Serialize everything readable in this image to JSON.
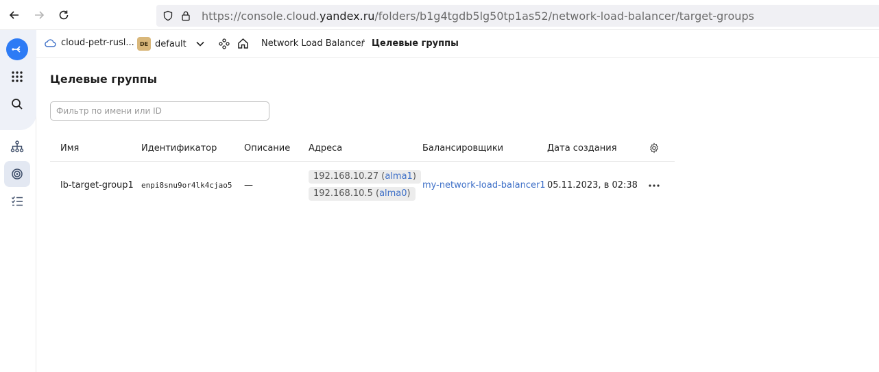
{
  "browser": {
    "url_prefix": "https://console.cloud.",
    "url_host": "yandex.ru",
    "url_path": "/folders/b1g4tgdb5lg50tp1as52/network-load-balancer/target-groups"
  },
  "header": {
    "cloud_name": "cloud-petr-rusl...",
    "folder_badge": "DE",
    "folder_name": "default",
    "breadcrumb_service": "Network Load Balancer",
    "breadcrumb_separator": "/",
    "breadcrumb_current": "Целевые группы"
  },
  "page": {
    "title": "Целевые группы",
    "filter_placeholder": "Фильтр по имени или ID"
  },
  "table": {
    "columns": [
      "Имя",
      "Идентификатор",
      "Описание",
      "Адреса",
      "Балансировщики",
      "Дата создания"
    ],
    "rows": [
      {
        "name": "lb-target-group1",
        "id": "enpi8snu9or4lk4cjao5",
        "description": "—",
        "addresses": [
          {
            "ip": "192.168.10.27",
            "host": "alma1"
          },
          {
            "ip": "192.168.10.5",
            "host": "alma0"
          }
        ],
        "balancer": "my-network-load-balancer1",
        "created": "05.11.2023, в 02:38"
      }
    ]
  },
  "colors": {
    "accent": "#2d7bf5",
    "link": "#3d6fc7",
    "rail_bg": "#eef1f8"
  }
}
